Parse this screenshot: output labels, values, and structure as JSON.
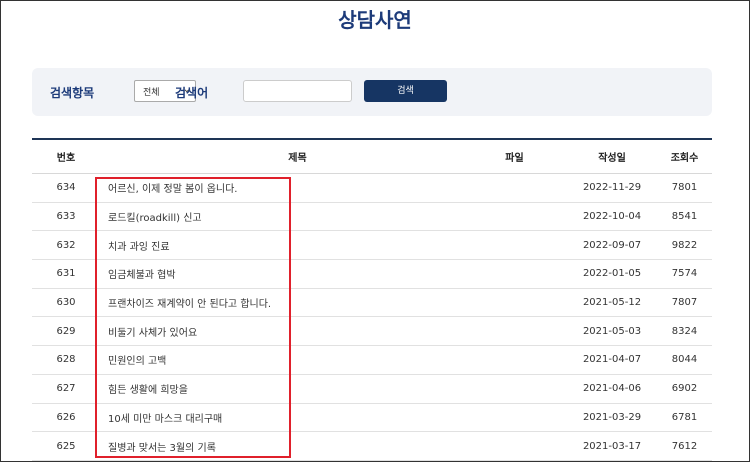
{
  "page": {
    "title": "상담사연"
  },
  "search": {
    "field_label": "검색항목",
    "field_selected": "전체",
    "keyword_label": "검색어",
    "keyword_value": "",
    "button_label": "검색"
  },
  "table": {
    "headers": {
      "num": "번호",
      "title": "제목",
      "file": "파일",
      "date": "작성일",
      "views": "조회수"
    },
    "rows": [
      {
        "num": "634",
        "title": "어르신, 이제 정말 봄이 옵니다.",
        "date": "2022-11-29",
        "views": "7801"
      },
      {
        "num": "633",
        "title": "로드킬(roadkill) 신고",
        "date": "2022-10-04",
        "views": "8541"
      },
      {
        "num": "632",
        "title": "치과 과잉 진료",
        "date": "2022-09-07",
        "views": "9822"
      },
      {
        "num": "631",
        "title": "임금체불과 협박",
        "date": "2022-01-05",
        "views": "7574"
      },
      {
        "num": "630",
        "title": "프랜차이즈 재계약이 안 된다고 합니다.",
        "date": "2021-05-12",
        "views": "7807"
      },
      {
        "num": "629",
        "title": "비둘기 사체가 있어요",
        "date": "2021-05-03",
        "views": "8324"
      },
      {
        "num": "628",
        "title": "민원인의 고백",
        "date": "2021-04-07",
        "views": "8044"
      },
      {
        "num": "627",
        "title": "힘든 생활에 희망을",
        "date": "2021-04-06",
        "views": "6902"
      },
      {
        "num": "626",
        "title": "10세 미만 마스크 대리구매",
        "date": "2021-03-29",
        "views": "6781"
      },
      {
        "num": "625",
        "title": "질병과 맞서는 3월의 기록",
        "date": "2021-03-17",
        "views": "7612"
      }
    ]
  },
  "colors": {
    "accent": "#1d3b7a",
    "button": "#163563",
    "highlight": "#e0202b"
  }
}
